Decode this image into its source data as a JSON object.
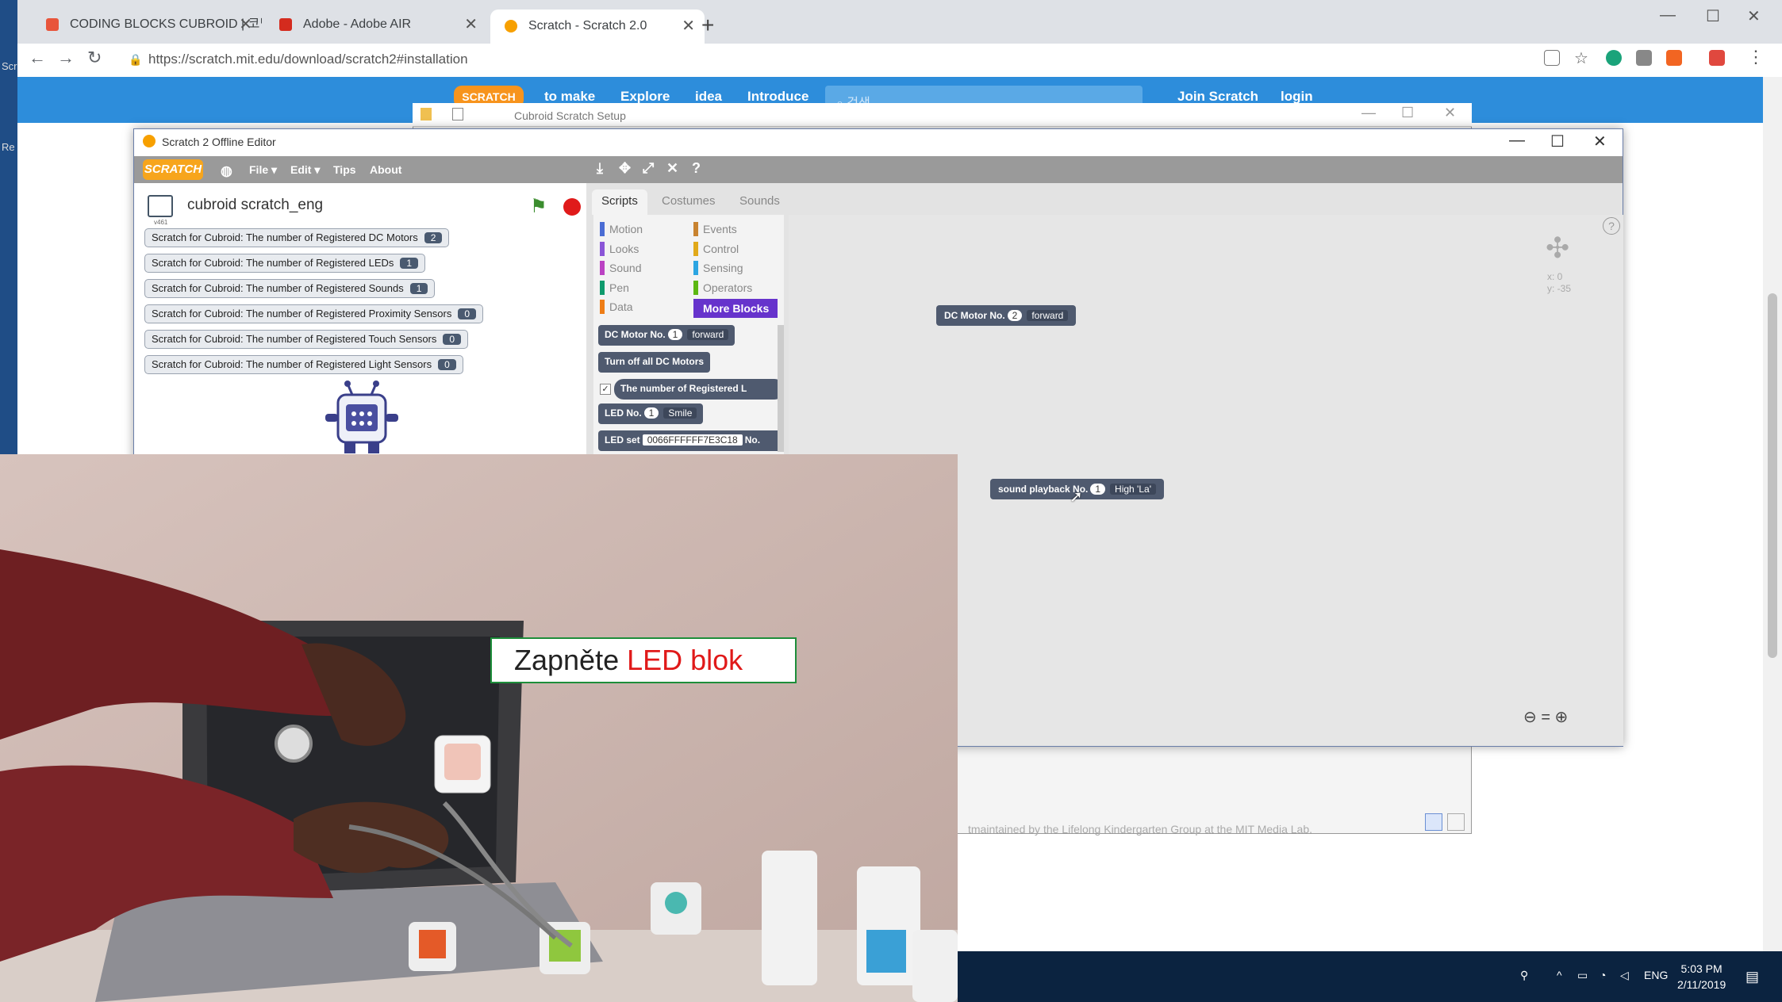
{
  "desktop": {
    "labels": [
      "Scr",
      "Re"
    ]
  },
  "browser": {
    "tabs": [
      {
        "title": "CODING BLOCKS CUBROID | 코딩",
        "favicon_color": "#e8553b"
      },
      {
        "title": "Adobe - Adobe AIR",
        "favicon_color": "#d42b1e"
      },
      {
        "title": "Scratch - Scratch 2.0",
        "favicon_color": "#f7a000"
      }
    ],
    "new_tab": "+",
    "url": "https://scratch.mit.edu/download/scratch2#installation"
  },
  "site": {
    "logo": "SCRATCH",
    "nav": [
      "to make",
      "Explore",
      "idea",
      "Introduce"
    ],
    "search_placeholder": "검색",
    "join": "Join Scratch",
    "login": "login",
    "page_text": "tmaintained by the Lifelong Kindergarten Group at the MIT Media Lab."
  },
  "setup_window": {
    "title": "Cubroid Scratch Setup"
  },
  "editor": {
    "title": "Scratch 2 Offline Editor",
    "menu": {
      "logo": "SCRATCH",
      "file": "File ▾",
      "edit": "Edit ▾",
      "tips": "Tips",
      "about": "About"
    },
    "sprite_name": "cubroid scratch_eng",
    "sprite_version": "v461",
    "monitors": [
      {
        "label": "Scratch for Cubroid: The number of Registered DC Motors",
        "value": "2"
      },
      {
        "label": "Scratch for Cubroid: The number of Registered LEDs",
        "value": "1"
      },
      {
        "label": "Scratch for Cubroid: The number of Registered Sounds",
        "value": "1"
      },
      {
        "label": "Scratch for Cubroid: The number of Registered Proximity Sensors",
        "value": "0"
      },
      {
        "label": "Scratch for Cubroid: The number of Registered Touch Sensors",
        "value": "0"
      },
      {
        "label": "Scratch for Cubroid: The number of Registered Light Sensors",
        "value": "0"
      }
    ],
    "tabs": [
      "Scripts",
      "Costumes",
      "Sounds"
    ],
    "categories_left": [
      {
        "name": "Motion",
        "color": "#4a6cd4"
      },
      {
        "name": "Looks",
        "color": "#8a55d7"
      },
      {
        "name": "Sound",
        "color": "#bb42c3"
      },
      {
        "name": "Pen",
        "color": "#0e9a6c"
      },
      {
        "name": "Data",
        "color": "#ee7d16"
      }
    ],
    "categories_right": [
      {
        "name": "Events",
        "color": "#c88330"
      },
      {
        "name": "Control",
        "color": "#e1a91a"
      },
      {
        "name": "Sensing",
        "color": "#2ca5e2"
      },
      {
        "name": "Operators",
        "color": "#5cb712"
      },
      {
        "name": "More Blocks",
        "color": "#6633cc"
      }
    ],
    "palette_blocks": {
      "dc_motor": {
        "label": "DC Motor No.",
        "num": "1",
        "dir": "forward"
      },
      "turn_off": "Turn off all DC Motors",
      "registered": "The number of Registered L",
      "led": {
        "label": "LED No.",
        "num": "1",
        "mode": "Smile"
      },
      "led_set": {
        "label": "LED set",
        "value": "0066FFFFFF7E3C18",
        "suffix": "No."
      }
    },
    "script_blocks": {
      "dc_motor": {
        "label": "DC Motor No.",
        "num": "2",
        "dir": "forward"
      },
      "sound": {
        "label": "sound playback No.",
        "num": "1",
        "value": "High 'La'"
      }
    },
    "stage_coords": {
      "x": "x: 0",
      "y": "y: -35"
    },
    "zoom": "⊖ = ⊕",
    "help": "?"
  },
  "caption": {
    "prefix": "Zapněte ",
    "highlight": "LED blok"
  },
  "taskbar": {
    "lang": "ENG",
    "time": "5:03 PM",
    "date": "2/11/2019"
  }
}
